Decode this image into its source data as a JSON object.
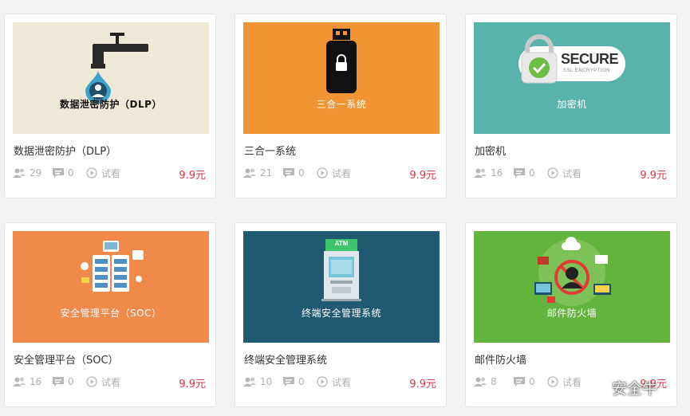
{
  "cards": [
    {
      "title": "数据泄密防护（DLP）",
      "thumb_label": "数据泄密防护（DLP）",
      "thumb_bg": "#efe9d8",
      "students": "29",
      "comments": "0",
      "preview_label": "试看",
      "price": "9.9元"
    },
    {
      "title": "三合一系统",
      "thumb_label": "三合一系统",
      "thumb_bg": "#f29433",
      "students": "21",
      "comments": "0",
      "preview_label": "试看",
      "price": "9.9元"
    },
    {
      "title": "加密机",
      "thumb_label": "加密机",
      "thumb_bg": "#58b3ad",
      "badge_main": "SECURE",
      "badge_sub": "SSL ENCRYPTION",
      "students": "16",
      "comments": "0",
      "preview_label": "试看",
      "price": "9.9元"
    },
    {
      "title": "安全管理平台（SOC）",
      "thumb_label": "安全管理平台（SOC）",
      "thumb_bg": "#f08a4b",
      "students": "16",
      "comments": "0",
      "preview_label": "试看",
      "price": "9.9元"
    },
    {
      "title": "终端安全管理系统",
      "thumb_label": "终端安全管理系统",
      "thumb_bg": "#1f5a70",
      "atm_label": "ATM",
      "students": "10",
      "comments": "0",
      "preview_label": "试看",
      "price": "9.9元"
    },
    {
      "title": "邮件防火墙",
      "thumb_label": "邮件防火墙",
      "thumb_bg": "#62b43c",
      "students": "8",
      "comments": "0",
      "preview_label": "试看",
      "price": "9.9元"
    }
  ],
  "watermark": {
    "text": "安全牛"
  },
  "colors": {
    "price": "#e0344a",
    "meta": "#b0b0b0"
  },
  "icons": [
    "people-icon",
    "comment-icon",
    "play-circle-icon"
  ]
}
